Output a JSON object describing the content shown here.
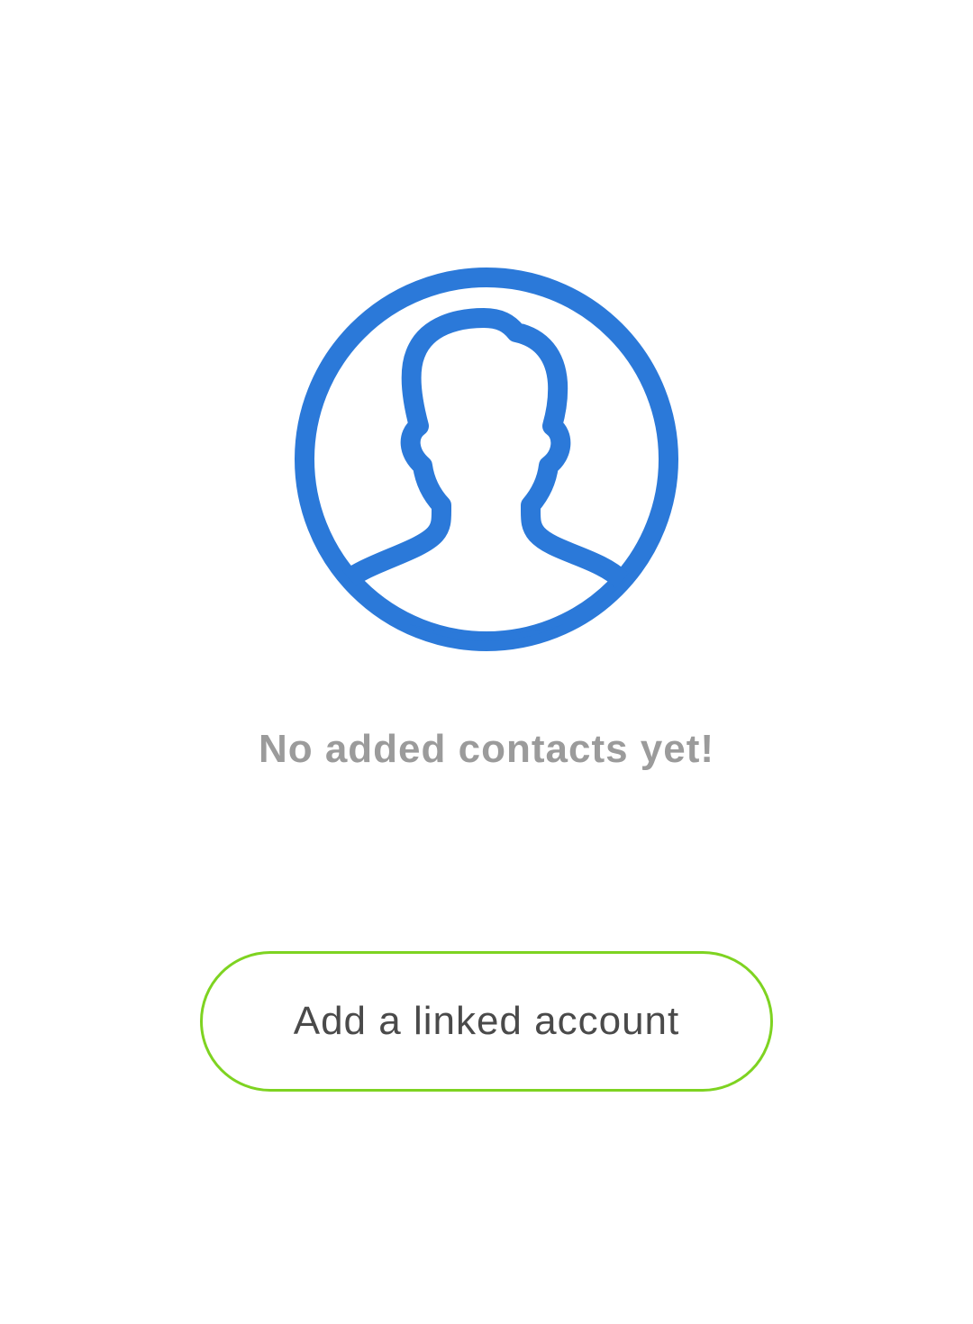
{
  "empty_state": {
    "icon": "person-silhouette-icon",
    "icon_color": "#2b79d9",
    "message": "No added contacts yet!",
    "message_color": "#9b9b9b"
  },
  "actions": {
    "add_linked_account_label": "Add a linked account",
    "button_border_color": "#7ed321",
    "button_text_color": "#4a4a4a"
  }
}
